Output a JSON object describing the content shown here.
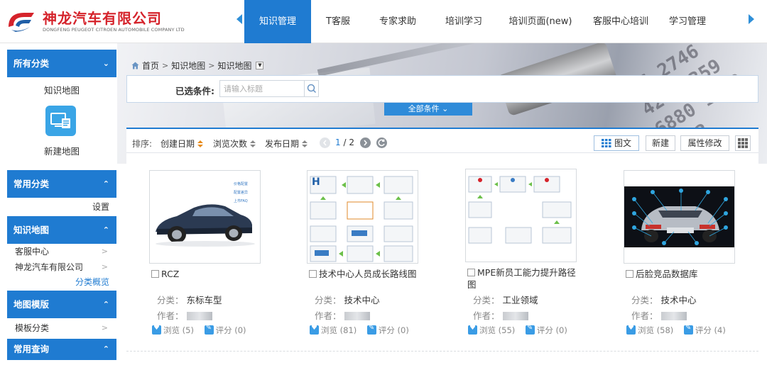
{
  "header": {
    "company_cn": "神龙汽车有限公司",
    "company_en": "DONGFENG PEUGEOT CITROEN AUTOMOBILE COMPANY LTD",
    "nav": [
      {
        "label": "知识管理",
        "active": true
      },
      {
        "label": "T客服",
        "active": false
      },
      {
        "label": "专家求助",
        "active": false
      },
      {
        "label": "培训学习",
        "active": false
      },
      {
        "label": "培训页面(new)",
        "active": false
      },
      {
        "label": "客服中心培训",
        "active": false
      },
      {
        "label": "学习管理",
        "active": false
      }
    ]
  },
  "sidebar": {
    "all_categories": "所有分类",
    "knowledge_map_title": "知识地图",
    "new_map_label": "新建地图",
    "common_categories": "常用分类",
    "settings": "设置",
    "knowledge_map": "知识地图",
    "map_items": [
      "客服中心",
      "神龙汽车有限公司"
    ],
    "category_overview": "分类概览",
    "map_template": "地图模版",
    "template_items": [
      "模板分类"
    ],
    "common_query": "常用查询"
  },
  "breadcrumb": {
    "home": "首页",
    "level1": "知识地图",
    "level2": "知识地图"
  },
  "filter": {
    "label": "已选条件:",
    "placeholder": "请输入标题",
    "all_conditions": "全部条件"
  },
  "toolbar": {
    "sort_label": "排序:",
    "sort_options": [
      "创建日期",
      "浏览次数",
      "发布日期"
    ],
    "page_current": "1",
    "page_total": "/ 2",
    "view_label": "图文",
    "new_label": "新建",
    "attr_label": "属性修改"
  },
  "cards": [
    {
      "title": "RCZ",
      "category_label": "分类：",
      "category": "东标车型",
      "author_label": "作者：",
      "views_label": "浏览",
      "views": "(5)",
      "rating_label": "评分",
      "rating": "(0)"
    },
    {
      "title": "技术中心人员成长路线图",
      "category_label": "分类：",
      "category": "技术中心",
      "author_label": "作者：",
      "views_label": "浏览",
      "views": "(81)",
      "rating_label": "评分",
      "rating": "(0)"
    },
    {
      "title": "MPE新员工能力提升路径图",
      "category_label": "分类：",
      "category": "工业领域",
      "author_label": "作者：",
      "views_label": "浏览",
      "views": "(55)",
      "rating_label": "评分",
      "rating": "(0)"
    },
    {
      "title": "后脸竞品数据库",
      "category_label": "分类：",
      "category": "技术中心",
      "author_label": "作者：",
      "views_label": "浏览",
      "views": "(58)",
      "rating_label": "评分",
      "rating": "(4)"
    }
  ],
  "thumb_rcz_notes": [
    "价格配置",
    "配置差异",
    "上市FAQ"
  ],
  "colors": {
    "brand_red": "#d5232b",
    "accent_blue": "#1f7bd1"
  }
}
